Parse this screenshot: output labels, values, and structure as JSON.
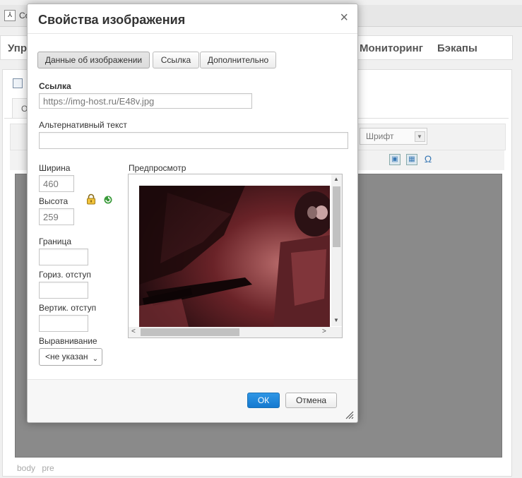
{
  "background": {
    "window_title": "Co",
    "nav": {
      "item_upr": "Упр",
      "item_monitoring": "Мониторинг",
      "item_backups": "Бэкапы"
    },
    "editor_tab": "О",
    "font_select": "Шрифт",
    "status_path": [
      "body",
      "pre"
    ]
  },
  "dialog": {
    "title": "Свойства изображения",
    "close": "×",
    "tabs": [
      {
        "label": "Данные об изображении",
        "active": true
      },
      {
        "label": "Ссылка",
        "active": false
      },
      {
        "label": "Дополнительно",
        "active": false
      }
    ],
    "url_label": "Ссылка",
    "url_value": "https://img-host.ru/E48v.jpg",
    "alt_label": "Альтернативный текст",
    "alt_value": "",
    "width_label": "Ширина",
    "width_value": "460",
    "height_label": "Высота",
    "height_value": "259",
    "border_label": "Граница",
    "border_value": "",
    "hspace_label": "Гориз. отступ",
    "hspace_value": "",
    "vspace_label": "Вертик. отступ",
    "vspace_value": "",
    "align_label": "Выравнивание",
    "align_value": "<не указан",
    "preview_label": "Предпросмотр",
    "ok_label": "ОК",
    "cancel_label": "Отмена"
  },
  "colors": {
    "primary_button": "#1579cf",
    "preview_tint": "#5a1f24"
  }
}
